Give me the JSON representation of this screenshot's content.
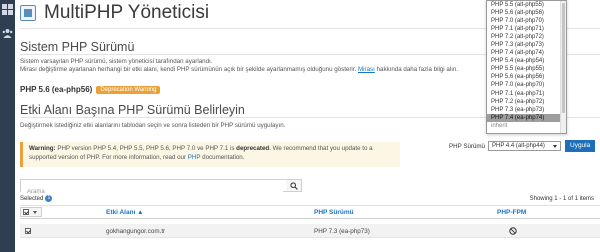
{
  "page": {
    "title": "MultiPHP Yöneticisi"
  },
  "system": {
    "title": "Sistem PHP Sürümü",
    "desc1": "Sistem varsayılan PHP sürümü, sistem yöneticisi tarafından ayarlandı.",
    "desc2_before": "Mirası değiştirme ayarlanan herhangi bir etki alanı, kendi PHP sürümünün açık bir şekilde ayarlanmamış olduğunu gösterir.",
    "desc2_link": "Mirası",
    "desc2_after": "hakkında daha fazla bilgi alın.",
    "current_version": "PHP 5.6 (ea-php56)",
    "badge": "Deprecation Warning"
  },
  "domains": {
    "title": "Etki Alanı Başına PHP Sürümü Belirleyin",
    "desc": "Değiştirmek istediğiniz etki alanlarını tablodan seçin ve sonra listeden bir PHP sürümü uygulayın."
  },
  "warning": {
    "label": "Warning:",
    "text1": "PHP version PHP 5.4, PHP 5.5, PHP 5.6, PHP 7.0 ve PHP 7.1 is",
    "bold": "deprecated",
    "text2": ". We recommend that you update to a supported version of PHP. For more information, read our",
    "link": "PHP",
    "text3": "documentation."
  },
  "search": {
    "placeholder": "Arama"
  },
  "selection": {
    "label": "Selected",
    "count": "1",
    "showing": "Showing 1 - 1 of 1 items"
  },
  "table": {
    "headers": {
      "domain": "Etki Alanı ▲",
      "php_version": "PHP Sürümü",
      "php_fpm": "PHP-FPM"
    },
    "rows": [
      {
        "domain": "gokhangungor.com.tr",
        "php_version": "PHP 7.3 (ea-php73)"
      }
    ]
  },
  "php_select": {
    "label": "PHP Sürümü",
    "selected": "PHP 4.4 (alt-php44)",
    "apply": "Uygula",
    "options": [
      "PHP 5.5 (alt-php55)",
      "PHP 5.6 (alt-php56)",
      "PHP 7.0 (alt-php70)",
      "PHP 7.1 (alt-php71)",
      "PHP 7.2 (alt-php72)",
      "PHP 7.3 (alt-php73)",
      "PHP 7.4 (alt-php74)",
      "PHP 5.4 (ea-php54)",
      "PHP 5.5 (ea-php55)",
      "PHP 5.6 (ea-php56)",
      "PHP 7.0 (ea-php70)",
      "PHP 7.1 (ea-php71)",
      "PHP 7.2 (ea-php72)",
      "PHP 7.3 (ea-php73)",
      "PHP 7.4 (ea-php74)",
      "inherit"
    ],
    "highlighted": "PHP 7.4 (ea-php74)"
  },
  "colors": {
    "accent": "#1e6fb8",
    "link": "#1a73c8",
    "warning": "#e9a23b",
    "rail": "#2f3f51"
  },
  "icons": {
    "rail": [
      "grid-icon",
      "users-icon"
    ],
    "search": "search-icon",
    "fpm": "block-icon"
  }
}
